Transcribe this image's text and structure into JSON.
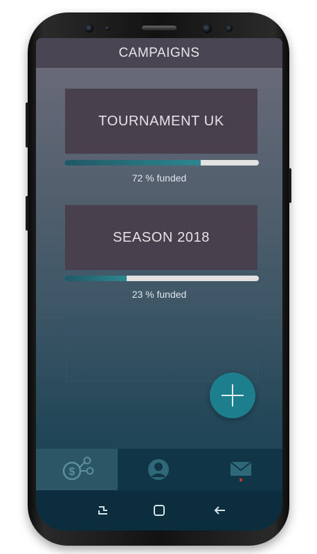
{
  "header": {
    "title": "CAMPAIGNS"
  },
  "campaigns": [
    {
      "name": "TOURNAMENT UK",
      "progress": 0.7,
      "funded_label": "72 % funded"
    },
    {
      "name": "SEASON 2018",
      "progress": 0.32,
      "funded_label": "23 % funded"
    }
  ],
  "tabs": [
    {
      "name": "funding",
      "icon": "dollar-network-icon",
      "active": true
    },
    {
      "name": "profile",
      "icon": "user-icon",
      "active": false
    },
    {
      "name": "messages",
      "icon": "mail-icon",
      "active": false,
      "badge": true
    }
  ],
  "system_nav": [
    {
      "icon": "recent-apps-icon"
    },
    {
      "icon": "home-icon"
    },
    {
      "icon": "back-arrow-icon"
    }
  ],
  "colors": {
    "header_bg": "#4a4553",
    "card_bg": "#48414d",
    "progress_fill": "#2d8790",
    "progress_track": "#e2e2e2",
    "fab": "#1d7f8e",
    "tabbar": "#0f3546",
    "badge": "#e0332f"
  }
}
